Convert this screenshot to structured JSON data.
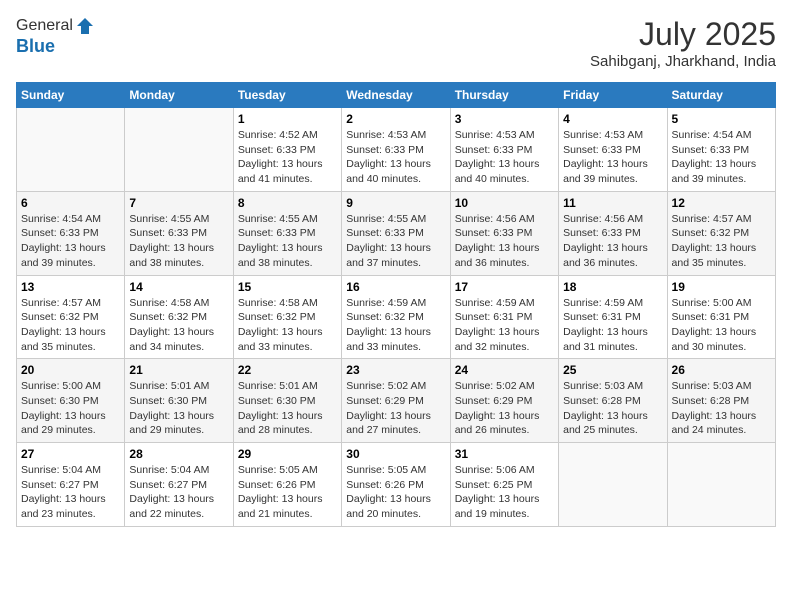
{
  "header": {
    "logo_general": "General",
    "logo_blue": "Blue",
    "month_year": "July 2025",
    "location": "Sahibganj, Jharkhand, India"
  },
  "days_of_week": [
    "Sunday",
    "Monday",
    "Tuesday",
    "Wednesday",
    "Thursday",
    "Friday",
    "Saturday"
  ],
  "weeks": [
    [
      {
        "day": "",
        "info": ""
      },
      {
        "day": "",
        "info": ""
      },
      {
        "day": "1",
        "info": "Sunrise: 4:52 AM\nSunset: 6:33 PM\nDaylight: 13 hours and 41 minutes."
      },
      {
        "day": "2",
        "info": "Sunrise: 4:53 AM\nSunset: 6:33 PM\nDaylight: 13 hours and 40 minutes."
      },
      {
        "day": "3",
        "info": "Sunrise: 4:53 AM\nSunset: 6:33 PM\nDaylight: 13 hours and 40 minutes."
      },
      {
        "day": "4",
        "info": "Sunrise: 4:53 AM\nSunset: 6:33 PM\nDaylight: 13 hours and 39 minutes."
      },
      {
        "day": "5",
        "info": "Sunrise: 4:54 AM\nSunset: 6:33 PM\nDaylight: 13 hours and 39 minutes."
      }
    ],
    [
      {
        "day": "6",
        "info": "Sunrise: 4:54 AM\nSunset: 6:33 PM\nDaylight: 13 hours and 39 minutes."
      },
      {
        "day": "7",
        "info": "Sunrise: 4:55 AM\nSunset: 6:33 PM\nDaylight: 13 hours and 38 minutes."
      },
      {
        "day": "8",
        "info": "Sunrise: 4:55 AM\nSunset: 6:33 PM\nDaylight: 13 hours and 38 minutes."
      },
      {
        "day": "9",
        "info": "Sunrise: 4:55 AM\nSunset: 6:33 PM\nDaylight: 13 hours and 37 minutes."
      },
      {
        "day": "10",
        "info": "Sunrise: 4:56 AM\nSunset: 6:33 PM\nDaylight: 13 hours and 36 minutes."
      },
      {
        "day": "11",
        "info": "Sunrise: 4:56 AM\nSunset: 6:33 PM\nDaylight: 13 hours and 36 minutes."
      },
      {
        "day": "12",
        "info": "Sunrise: 4:57 AM\nSunset: 6:32 PM\nDaylight: 13 hours and 35 minutes."
      }
    ],
    [
      {
        "day": "13",
        "info": "Sunrise: 4:57 AM\nSunset: 6:32 PM\nDaylight: 13 hours and 35 minutes."
      },
      {
        "day": "14",
        "info": "Sunrise: 4:58 AM\nSunset: 6:32 PM\nDaylight: 13 hours and 34 minutes."
      },
      {
        "day": "15",
        "info": "Sunrise: 4:58 AM\nSunset: 6:32 PM\nDaylight: 13 hours and 33 minutes."
      },
      {
        "day": "16",
        "info": "Sunrise: 4:59 AM\nSunset: 6:32 PM\nDaylight: 13 hours and 33 minutes."
      },
      {
        "day": "17",
        "info": "Sunrise: 4:59 AM\nSunset: 6:31 PM\nDaylight: 13 hours and 32 minutes."
      },
      {
        "day": "18",
        "info": "Sunrise: 4:59 AM\nSunset: 6:31 PM\nDaylight: 13 hours and 31 minutes."
      },
      {
        "day": "19",
        "info": "Sunrise: 5:00 AM\nSunset: 6:31 PM\nDaylight: 13 hours and 30 minutes."
      }
    ],
    [
      {
        "day": "20",
        "info": "Sunrise: 5:00 AM\nSunset: 6:30 PM\nDaylight: 13 hours and 29 minutes."
      },
      {
        "day": "21",
        "info": "Sunrise: 5:01 AM\nSunset: 6:30 PM\nDaylight: 13 hours and 29 minutes."
      },
      {
        "day": "22",
        "info": "Sunrise: 5:01 AM\nSunset: 6:30 PM\nDaylight: 13 hours and 28 minutes."
      },
      {
        "day": "23",
        "info": "Sunrise: 5:02 AM\nSunset: 6:29 PM\nDaylight: 13 hours and 27 minutes."
      },
      {
        "day": "24",
        "info": "Sunrise: 5:02 AM\nSunset: 6:29 PM\nDaylight: 13 hours and 26 minutes."
      },
      {
        "day": "25",
        "info": "Sunrise: 5:03 AM\nSunset: 6:28 PM\nDaylight: 13 hours and 25 minutes."
      },
      {
        "day": "26",
        "info": "Sunrise: 5:03 AM\nSunset: 6:28 PM\nDaylight: 13 hours and 24 minutes."
      }
    ],
    [
      {
        "day": "27",
        "info": "Sunrise: 5:04 AM\nSunset: 6:27 PM\nDaylight: 13 hours and 23 minutes."
      },
      {
        "day": "28",
        "info": "Sunrise: 5:04 AM\nSunset: 6:27 PM\nDaylight: 13 hours and 22 minutes."
      },
      {
        "day": "29",
        "info": "Sunrise: 5:05 AM\nSunset: 6:26 PM\nDaylight: 13 hours and 21 minutes."
      },
      {
        "day": "30",
        "info": "Sunrise: 5:05 AM\nSunset: 6:26 PM\nDaylight: 13 hours and 20 minutes."
      },
      {
        "day": "31",
        "info": "Sunrise: 5:06 AM\nSunset: 6:25 PM\nDaylight: 13 hours and 19 minutes."
      },
      {
        "day": "",
        "info": ""
      },
      {
        "day": "",
        "info": ""
      }
    ]
  ]
}
